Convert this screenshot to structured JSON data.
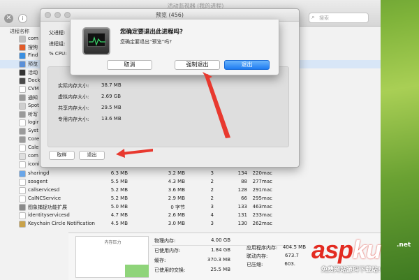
{
  "activity_monitor": {
    "title": "活动监视器 (我的进程)",
    "close_glyph": "✕",
    "info_glyph": "i",
    "search_placeholder": "搜索",
    "column_process": "进程名称",
    "partial_rows": [
      {
        "name": "com",
        "color": "#c0c0c0"
      },
      {
        "name": "搜狗",
        "color": "#e25c2a"
      },
      {
        "name": "Find",
        "color": "#3b8fe0"
      },
      {
        "name": "预览",
        "color": "#5a8fd8",
        "selected": true
      },
      {
        "name": "活动",
        "color": "#333333"
      },
      {
        "name": "Dock",
        "color": "#4a4a4a"
      },
      {
        "name": "CVM",
        "color": "#ffffff"
      },
      {
        "name": "通知",
        "color": "#9a9a9a"
      },
      {
        "name": "Spot",
        "color": "#cfcfcf"
      },
      {
        "name": "听写",
        "color": "#9a9a9a"
      },
      {
        "name": "logir",
        "color": "#ffffff"
      },
      {
        "name": "Syst",
        "color": "#9a9a9a"
      },
      {
        "name": "Core",
        "color": "#9a9a9a"
      },
      {
        "name": "Cale",
        "color": "#ffffff"
      },
      {
        "name": "com",
        "color": "#e0e0e0"
      },
      {
        "name": "iconi",
        "color": "#ffffff"
      }
    ],
    "rows": [
      {
        "name": "sharingd",
        "mem": "6.3 MB",
        "comp": "3.2 MB",
        "threads": "3",
        "ports": "134",
        "pid": "220",
        "user": "mac",
        "color": "#6aa6e8"
      },
      {
        "name": "soagent",
        "mem": "5.5 MB",
        "comp": "4.3 MB",
        "threads": "2",
        "ports": "88",
        "pid": "277",
        "user": "mac",
        "color": "#ffffff"
      },
      {
        "name": "callservicesd",
        "mem": "5.2 MB",
        "comp": "3.6 MB",
        "threads": "2",
        "ports": "128",
        "pid": "291",
        "user": "mac",
        "color": "#ffffff"
      },
      {
        "name": "CalNCService",
        "mem": "5.2 MB",
        "comp": "2.9 MB",
        "threads": "2",
        "ports": "66",
        "pid": "295",
        "user": "mac",
        "color": "#ffffff"
      },
      {
        "name": "图象捕捉功能扩展",
        "mem": "5.0 MB",
        "comp": "0 字节",
        "threads": "3",
        "ports": "133",
        "pid": "463",
        "user": "mac",
        "color": "#8a8a8a"
      },
      {
        "name": "identityservicesd",
        "mem": "4.7 MB",
        "comp": "2.6 MB",
        "threads": "4",
        "ports": "131",
        "pid": "233",
        "user": "mac",
        "color": "#ffffff"
      },
      {
        "name": "Keychain Circle Notification",
        "mem": "4.5 MB",
        "comp": "3.0 MB",
        "threads": "3",
        "ports": "130",
        "pid": "262",
        "user": "mac",
        "color": "#c9a24a"
      }
    ],
    "memory": {
      "pressure_label": "内存压力",
      "pressure_level": 0.3,
      "pressure_color": "#8fd47a",
      "physical_label": "物理内存:",
      "physical_value": "4.00 GB",
      "used_label": "已使用内存:",
      "used_value": "1.84 GB",
      "cache_label": "缓存:",
      "cache_value": "370.3 MB",
      "swap_label": "已使用的交换:",
      "swap_value": "25.5 MB",
      "app_label": "应用程序内存:",
      "app_value": "404.5 MB",
      "wired_label": "联动内存:",
      "wired_value": "673.7",
      "compressed_label": "已压缩:",
      "compressed_value": "603."
    }
  },
  "preview_window": {
    "title": "预览 (456)",
    "parent_label": "父进程:",
    "group_label": "进程组:",
    "cpu_label": "% CPU:",
    "mem_rows": [
      {
        "label": "实际内存大小:",
        "value": "38.7 MB"
      },
      {
        "label": "虚拟内存大小:",
        "value": "2.69 GB"
      },
      {
        "label": "共享内存大小:",
        "value": "29.5 MB"
      },
      {
        "label": "专用内存大小:",
        "value": "13.6 MB"
      }
    ],
    "sample_button": "取样",
    "quit_button": "退出"
  },
  "alert": {
    "title": "您确定要退出此进程吗?",
    "message": "您确定要退出“预览”吗?",
    "cancel_button": "取消",
    "force_quit_button": "强制退出",
    "quit_button": "退出",
    "accent": "#1e7cf2"
  },
  "watermark": {
    "logo_a": "asp",
    "logo_k": "ku",
    "net": ".net",
    "subtitle": "免费网站源码下载站!"
  },
  "colors": {
    "arrow": "#e8392f",
    "selection": "#d8e6f7"
  }
}
